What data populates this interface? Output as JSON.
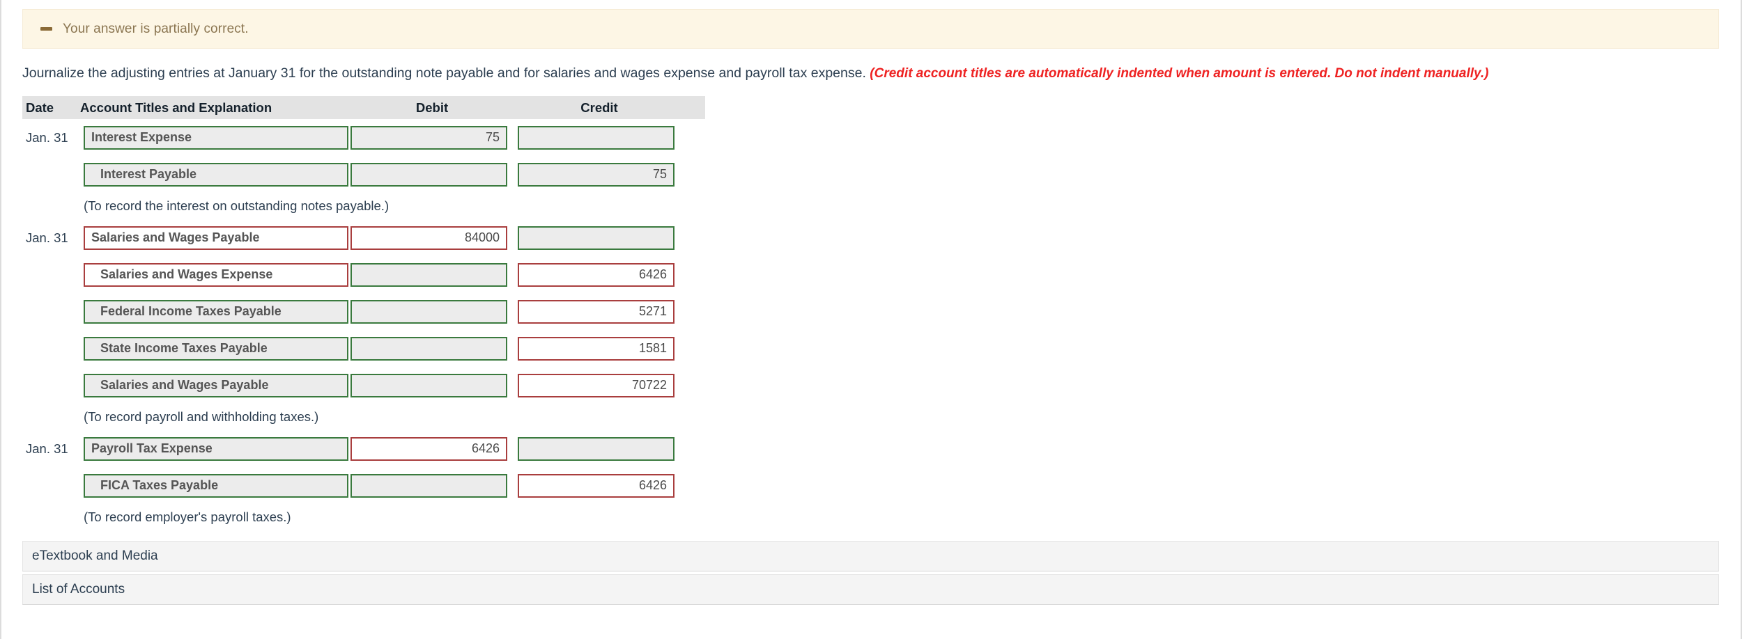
{
  "alert": {
    "icon": "minus-icon",
    "message": "Your answer is partially correct."
  },
  "instruction": {
    "text": "Journalize the adjusting entries at January 31 for the outstanding note payable and for salaries and wages expense and payroll tax expense. ",
    "note": "(Credit account titles are automatically indented when amount is entered. Do not indent manually.)"
  },
  "journal": {
    "headers": {
      "date": "Date",
      "account": "Account Titles and Explanation",
      "debit": "Debit",
      "credit": "Credit"
    },
    "rows": [
      {
        "date": "Jan. 31",
        "account": "Interest Expense",
        "account_indent": false,
        "account_state": "correct",
        "debit": "75",
        "debit_state": "correct",
        "credit": "",
        "credit_state": "correct"
      },
      {
        "date": "",
        "account": "Interest Payable",
        "account_indent": true,
        "account_state": "correct",
        "debit": "",
        "debit_state": "correct",
        "credit": "75",
        "credit_state": "correct"
      },
      {
        "type": "explanation",
        "text": "(To record the interest on outstanding notes payable.)"
      },
      {
        "date": "Jan. 31",
        "account": "Salaries and Wages Payable",
        "account_indent": false,
        "account_state": "wrong",
        "debit": "84000",
        "debit_state": "wrong",
        "credit": "",
        "credit_state": "correct"
      },
      {
        "date": "",
        "account": "Salaries and Wages Expense",
        "account_indent": true,
        "account_state": "wrong",
        "debit": "",
        "debit_state": "correct",
        "credit": "6426",
        "credit_state": "wrong"
      },
      {
        "date": "",
        "account": "Federal Income Taxes Payable",
        "account_indent": true,
        "account_state": "correct",
        "debit": "",
        "debit_state": "correct",
        "credit": "5271",
        "credit_state": "wrong"
      },
      {
        "date": "",
        "account": "State Income Taxes Payable",
        "account_indent": true,
        "account_state": "correct",
        "debit": "",
        "debit_state": "correct",
        "credit": "1581",
        "credit_state": "wrong"
      },
      {
        "date": "",
        "account": "Salaries and Wages Payable",
        "account_indent": true,
        "account_state": "correct",
        "debit": "",
        "debit_state": "correct",
        "credit": "70722",
        "credit_state": "wrong"
      },
      {
        "type": "explanation",
        "text": "(To record payroll and withholding taxes.)"
      },
      {
        "date": "Jan. 31",
        "account": "Payroll Tax Expense",
        "account_indent": false,
        "account_state": "correct",
        "debit": "6426",
        "debit_state": "wrong",
        "credit": "",
        "credit_state": "correct"
      },
      {
        "date": "",
        "account": "FICA Taxes Payable",
        "account_indent": true,
        "account_state": "correct",
        "debit": "",
        "debit_state": "correct",
        "credit": "6426",
        "credit_state": "wrong"
      },
      {
        "type": "explanation",
        "text": "(To record employer's payroll taxes.)"
      }
    ]
  },
  "bottom_bars": [
    {
      "label": "eTextbook and Media"
    },
    {
      "label": "List of Accounts"
    }
  ],
  "colors": {
    "correct_border": "#3a7a3e",
    "wrong_border": "#a93e3e",
    "alert_bg": "#fdf6e5",
    "alert_text": "#8a7550",
    "note_red": "#ee2222",
    "header_bg": "#e3e3e3",
    "field_bg": "#ececec"
  }
}
